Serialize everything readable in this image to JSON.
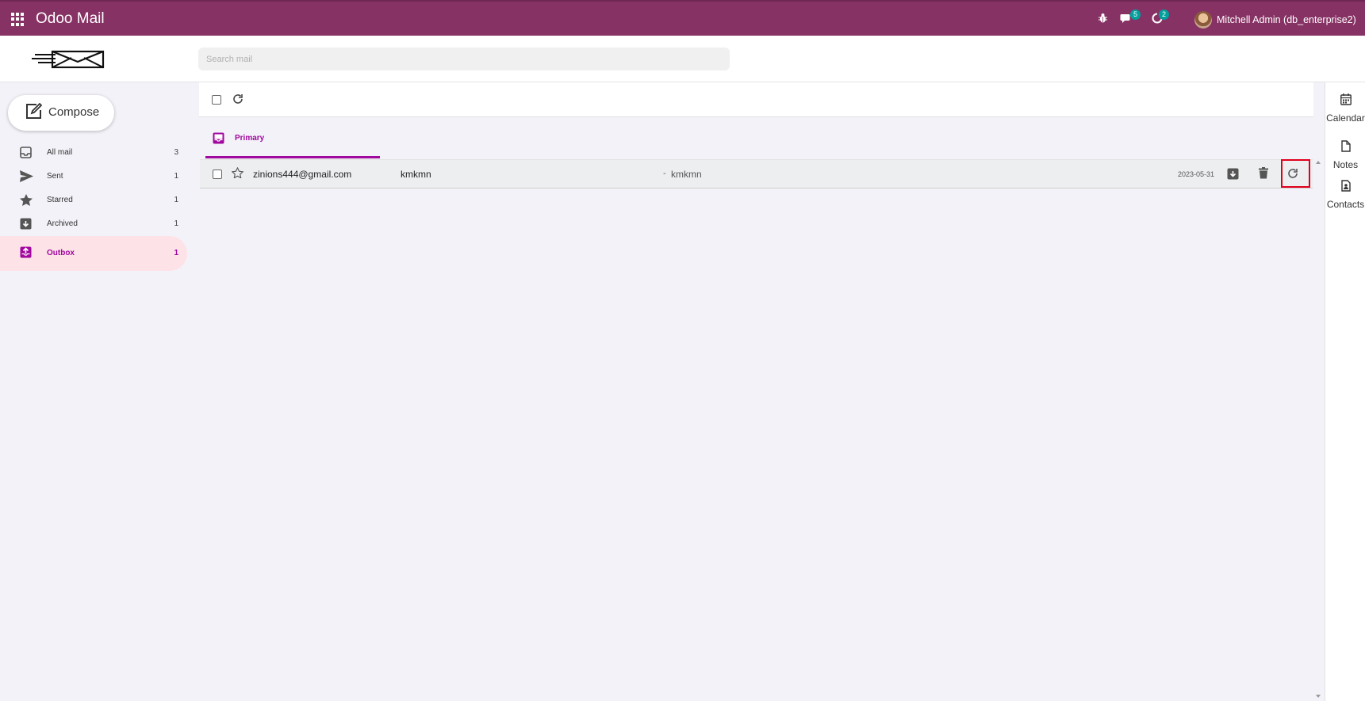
{
  "app": {
    "title": "Odoo Mail"
  },
  "topbar": {
    "messages_badge": "5",
    "activities_badge": "2",
    "user_name": "Mitchell Admin (db_enterprise2)"
  },
  "search": {
    "placeholder": "Search mail"
  },
  "sidebar": {
    "compose_label": "Compose",
    "items": [
      {
        "label": "All mail",
        "count": "3",
        "icon": "inbox-icon"
      },
      {
        "label": "Sent",
        "count": "1",
        "icon": "paper-plane-icon"
      },
      {
        "label": "Starred",
        "count": "1",
        "icon": "star-icon"
      },
      {
        "label": "Archived",
        "count": "1",
        "icon": "archive-icon"
      },
      {
        "label": "Outbox",
        "count": "1",
        "icon": "outbox-icon",
        "active": true
      }
    ]
  },
  "tabs": [
    {
      "label": "Primary",
      "active": true
    }
  ],
  "mails": [
    {
      "sender": "zinions444@gmail.com",
      "subject": "kmkmn",
      "separator": "-",
      "preview": "kmkmn",
      "date": "2023-05-31"
    }
  ],
  "rail": {
    "items": [
      {
        "label": "Calendar",
        "icon": "calendar-icon"
      },
      {
        "label": "Notes",
        "icon": "note-icon"
      },
      {
        "label": "Contacts",
        "icon": "contact-card-icon"
      }
    ]
  },
  "colors": {
    "brand": "#873264",
    "accent": "#a1089e",
    "active_bg": "#fde3e8",
    "badge": "#00a09d",
    "highlight": "#e0001b"
  }
}
